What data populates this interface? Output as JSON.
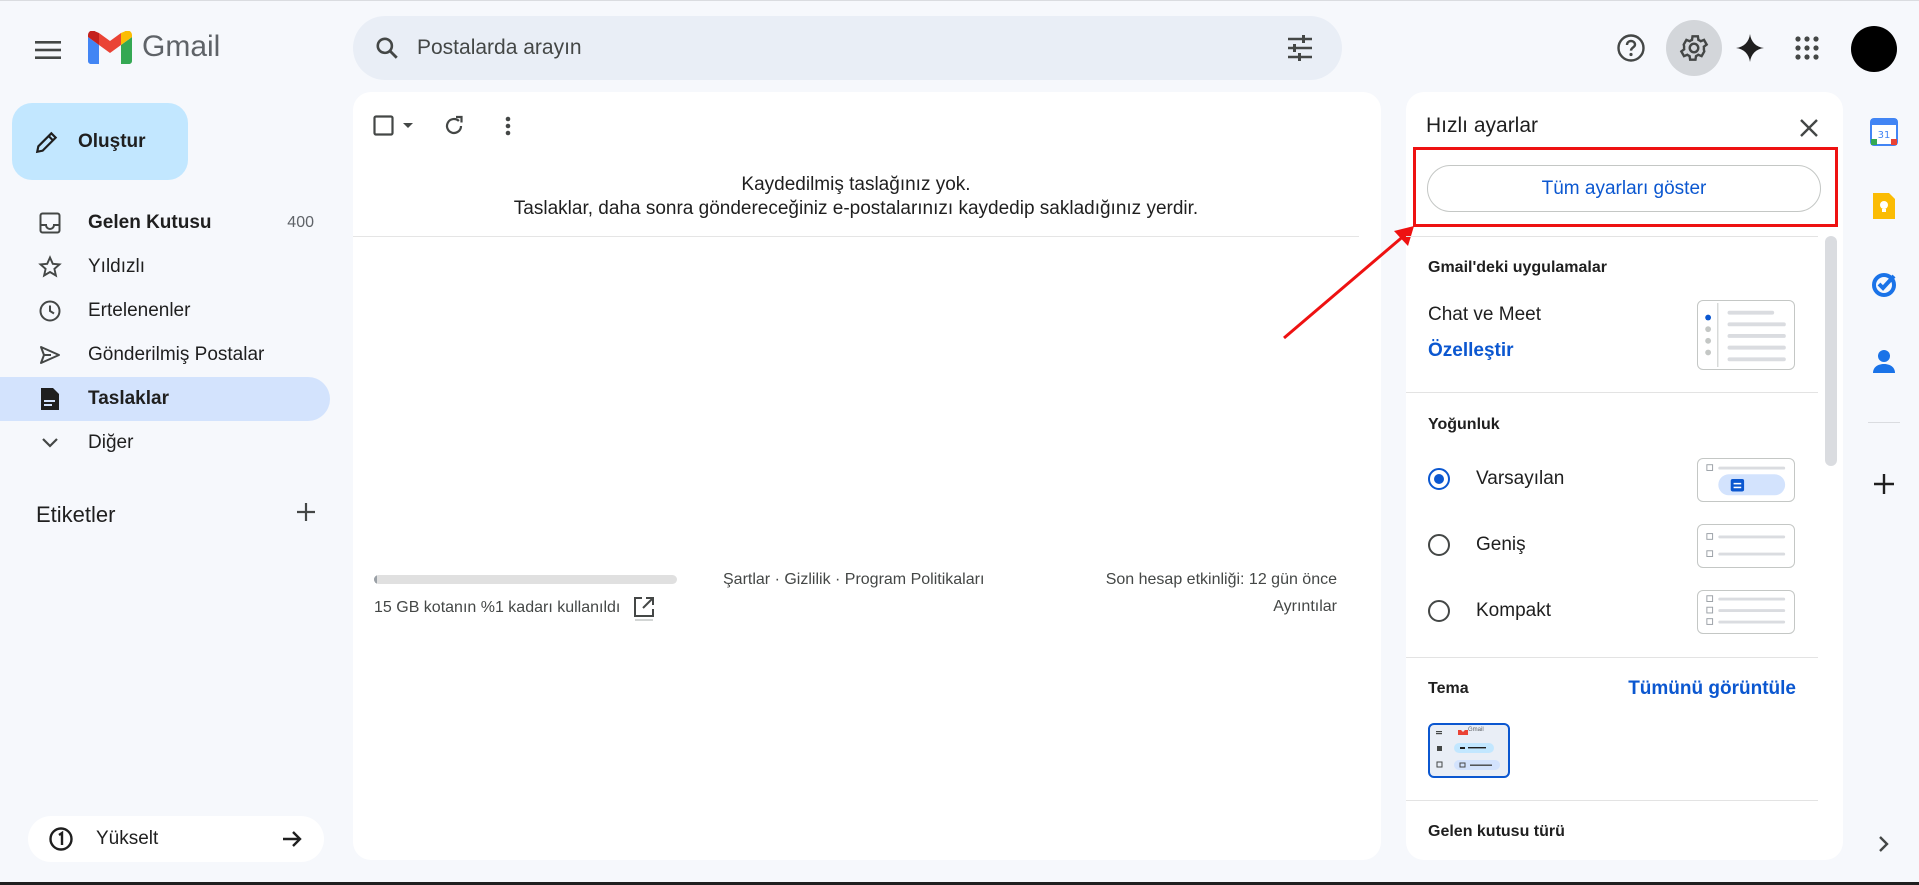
{
  "app": {
    "name": "Gmail"
  },
  "search": {
    "placeholder": "Postalarda arayın"
  },
  "compose": {
    "label": "Oluştur"
  },
  "nav": [
    {
      "label": "Gelen Kutusu",
      "count": "400"
    },
    {
      "label": "Yıldızlı"
    },
    {
      "label": "Ertelenenler"
    },
    {
      "label": "Gönderilmiş Postalar"
    },
    {
      "label": "Taslaklar",
      "active": true
    },
    {
      "label": "Diğer"
    }
  ],
  "labels": {
    "title": "Etiketler"
  },
  "upgrade": {
    "label": "Yükselt"
  },
  "main": {
    "empty_title": "Kaydedilmiş taslağınız yok.",
    "empty_desc": "Taslaklar, daha sonra göndereceğiniz e-postalarınızı kaydedip sakladığınız yerdir.",
    "storage_text": "15 GB kotanın %1 kadarı kullanıldı",
    "storage_fraction": 0.01,
    "footer_links": [
      "Şartlar",
      "Gizlilik",
      "Program Politikaları"
    ],
    "last_activity": "Son hesap etkinliği: 12 gün önce",
    "details": "Ayrıntılar"
  },
  "quick_settings": {
    "title": "Hızlı ayarlar",
    "all_settings": "Tüm ayarları göster",
    "apps_title": "Gmail'deki uygulamalar",
    "chat_meet": "Chat ve Meet",
    "customize": "Özelleştir",
    "density_title": "Yoğunluk",
    "density_options": [
      {
        "label": "Varsayılan",
        "selected": true
      },
      {
        "label": "Geniş",
        "selected": false
      },
      {
        "label": "Kompakt",
        "selected": false
      }
    ],
    "theme_title": "Tema",
    "see_all": "Tümünü görüntüle",
    "theme_thumb_label": "Gmail",
    "inbox_type_title": "Gelen kutusu türü"
  },
  "colors": {
    "accent": "#0b57d0",
    "highlight": "#ee1111",
    "compose_bg": "#c2e7ff",
    "active_nav": "#d3e3fd"
  }
}
